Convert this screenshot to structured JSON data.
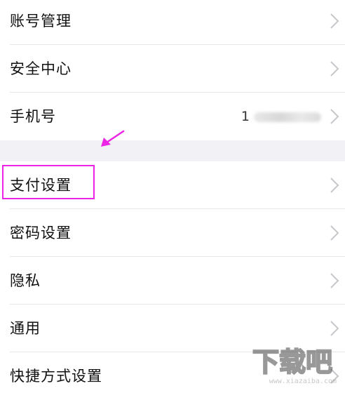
{
  "settings": {
    "items": [
      {
        "label": "账号管理"
      },
      {
        "label": "安全中心"
      },
      {
        "label": "手机号",
        "value": "1"
      },
      {
        "label": "支付设置"
      },
      {
        "label": "密码设置"
      },
      {
        "label": "隐私"
      },
      {
        "label": "通用"
      },
      {
        "label": "快捷方式设置"
      }
    ]
  },
  "annotation": {
    "color": "#ec24e6",
    "arrow_icon": "arrow-icon"
  },
  "watermark": {
    "text": "下载吧",
    "url": "www.xiazaiba.com"
  }
}
